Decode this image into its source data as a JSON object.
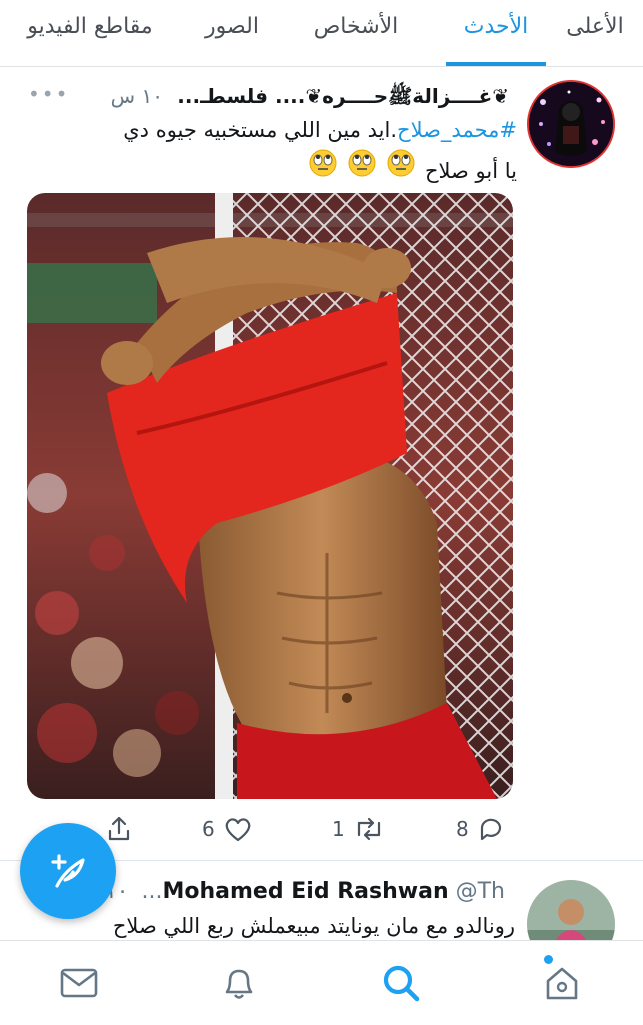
{
  "tabs": [
    {
      "label": "الأعلى",
      "active": false
    },
    {
      "label": "الأحدث",
      "active": true
    },
    {
      "label": "الأشخاص",
      "active": false
    },
    {
      "label": "الصور",
      "active": false
    },
    {
      "label": "مقاطع الفيديو",
      "active": false
    }
  ],
  "accent_color": "#1b95e0",
  "tweet1": {
    "display_name": "❦غــــزالةﷺحــــره❦.... فلسطـ...",
    "time": "١٠ س",
    "more": "•••",
    "hashtag": "#محمد_صلاح",
    "text_line1": ".ايد مين اللي مستخبيه جيوه دي",
    "text_line2": "يا أبو صلاح",
    "emojis": "🙄🙄🙄",
    "replies": "8",
    "retweets": "1",
    "likes": "6",
    "media_subject": "football-player-lifting-red-shirt-photo"
  },
  "tweet2": {
    "display_name": "Mohamed Eid Rashwan",
    "handle": "@Th...",
    "time": "١٠",
    "text": "رونالدو مع مان يونايتد مبيعملش ربع اللي صلاح"
  },
  "icons": {
    "compose": "compose-feather-icon",
    "home": "home-icon",
    "search": "search-icon",
    "notifications": "bell-icon",
    "messages": "envelope-icon"
  }
}
